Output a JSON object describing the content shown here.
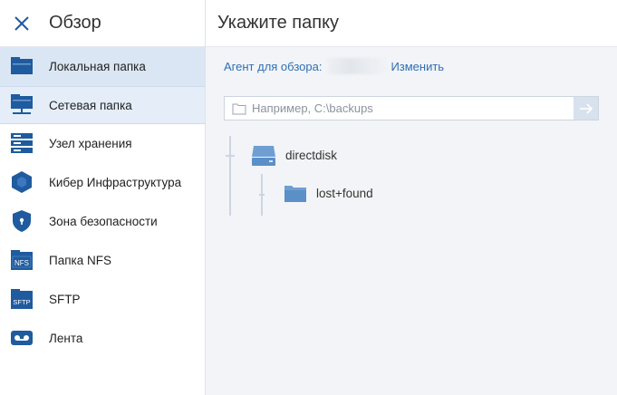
{
  "sidebar": {
    "title": "Обзор",
    "items": [
      {
        "label": "Локальная папка",
        "icon": "local-folder-icon"
      },
      {
        "label": "Сетевая папка",
        "icon": "network-folder-icon"
      },
      {
        "label": "Узел хранения",
        "icon": "storage-node-icon"
      },
      {
        "label": "Кибер Инфраструктура",
        "icon": "cyber-infrastructure-icon"
      },
      {
        "label": "Зона безопасности",
        "icon": "secure-zone-icon"
      },
      {
        "label": "Папка NFS",
        "icon": "nfs-folder-icon"
      },
      {
        "label": "SFTP",
        "icon": "sftp-icon"
      },
      {
        "label": "Лента",
        "icon": "tape-icon"
      }
    ],
    "icon_badges": {
      "nfs": "NFS",
      "sftp": "SFTP"
    }
  },
  "main": {
    "title": "Укажите папку",
    "agent_label": "Агент для обзора:",
    "agent_change": "Изменить",
    "path_placeholder": "Например, C:\\backups",
    "path_value": "",
    "tree": [
      {
        "label": "directdisk",
        "icon": "disk-icon"
      },
      {
        "label": "lost+found",
        "icon": "folder-icon"
      }
    ]
  },
  "colors": {
    "accent": "#2e6fb5",
    "icon_blue": "#1f5b9e",
    "active_bg": "#dbe6f4",
    "main_bg": "#f2f4f7"
  }
}
